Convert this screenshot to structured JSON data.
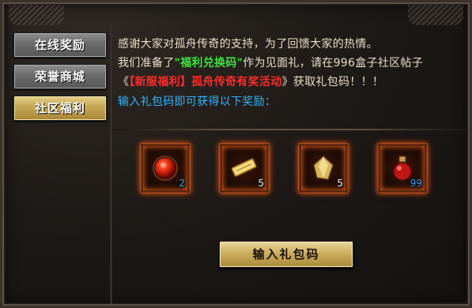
{
  "tabs": [
    {
      "label": "在线奖励",
      "active": false
    },
    {
      "label": "荣誉商城",
      "active": false
    },
    {
      "label": "社区福利",
      "active": true
    }
  ],
  "content": {
    "line1": "感谢大家对孤舟传奇的支持，为了回馈大家的热情。",
    "line2_pre": "我们准备了",
    "line2_code": "\"福利兑换码\"",
    "line2_post": "作为见面礼，请在996盒子社区帖子",
    "line3_open": "《",
    "line3_event": "【新服福利】孤舟传奇有奖活动",
    "line3_post": "》获取礼包码！！！",
    "line4": "输入礼包码即可获得以下奖励："
  },
  "rewards": [
    {
      "icon": "red-orb-icon",
      "count": "2"
    },
    {
      "icon": "gold-scroll-icon",
      "count": "5"
    },
    {
      "icon": "gold-crystal-icon",
      "count": "5"
    },
    {
      "icon": "red-potion-icon",
      "count": "99"
    }
  ],
  "button": {
    "label": "输入礼包码"
  },
  "colors": {
    "text": "#e8dfc9",
    "highlight_green": "#3fe03f",
    "highlight_red": "#ff2b2b",
    "info_blue": "#2fb4ff",
    "active_tab": "#c4a652",
    "inactive_tab": "#6b6b6b"
  }
}
